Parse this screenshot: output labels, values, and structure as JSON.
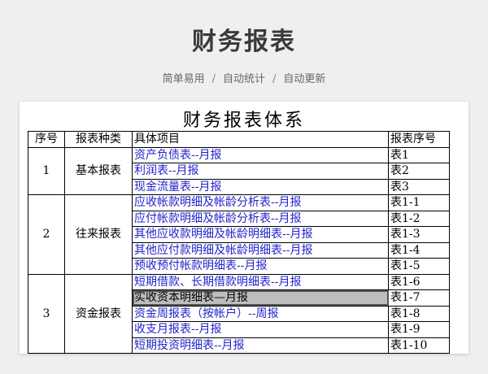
{
  "header": {
    "title": "财务报表",
    "features": [
      "简单易用",
      "自动统计",
      "自动更新"
    ],
    "separator": "/"
  },
  "sheet": {
    "title": "财务报表体系",
    "columns": [
      "序号",
      "报表种类",
      "具体项目",
      "报表序号"
    ],
    "groups": [
      {
        "no": "1",
        "category": "基本报表",
        "rows": [
          {
            "item": "资产负债表--月报",
            "code": "表1"
          },
          {
            "item": "利润表--月报",
            "code": "表2"
          },
          {
            "item": "现金流量表--月报",
            "code": "表3"
          }
        ]
      },
      {
        "no": "2",
        "category": "往来报表",
        "rows": [
          {
            "item": "应收帐款明细及帐龄分析表--月报",
            "code": "表1-1"
          },
          {
            "item": "应付帐款明细及帐龄分析表--月报",
            "code": "表1-2"
          },
          {
            "item": "其他应收款明细及帐龄明细表--月报",
            "code": "表1-3"
          },
          {
            "item": "其他应付款明细及帐龄明细表--月报",
            "code": "表1-4"
          },
          {
            "item": "预收预付帐款明细表--月报",
            "code": "表1-5"
          }
        ]
      },
      {
        "no": "3",
        "category": "资金报表",
        "rows": [
          {
            "item": "短期借款、长期借款明细表--月报",
            "code": "表1-6"
          },
          {
            "item": "实收资本明细表—月报",
            "code": "表1-7",
            "selected": true
          },
          {
            "item": "资金周报表（按帐户）--周报",
            "code": "表1-8"
          },
          {
            "item": "收支月报表--月报",
            "code": "表1-9"
          },
          {
            "item": "短期投资明细表--月报",
            "code": "表1-10"
          }
        ]
      }
    ]
  },
  "colors": {
    "link": "#2222cc",
    "selection": "#bdbdbd",
    "background": "#efefef"
  }
}
